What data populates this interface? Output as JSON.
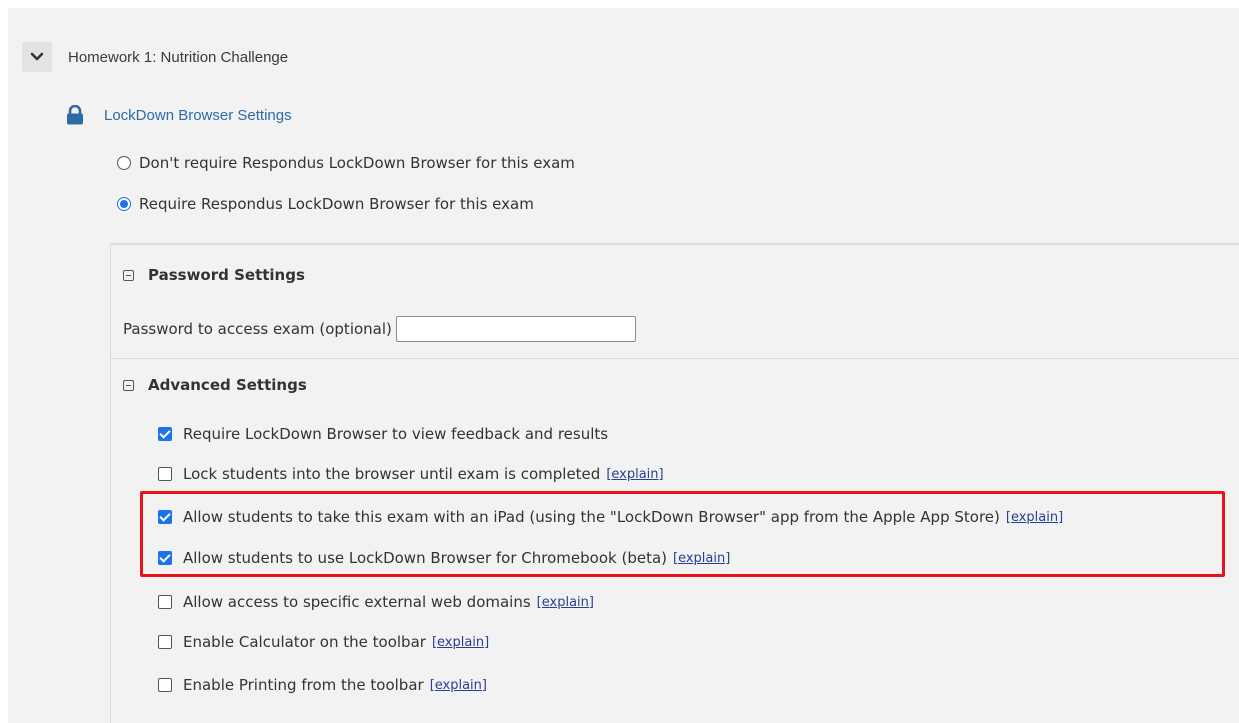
{
  "exam": {
    "title": "Homework 1: Nutrition Challenge"
  },
  "lockdown": {
    "link_label": "LockDown Browser Settings",
    "radio_options": [
      {
        "label": "Don't require Respondus LockDown Browser for this exam",
        "selected": false
      },
      {
        "label": "Require Respondus LockDown Browser for this exam",
        "selected": true
      }
    ]
  },
  "password_settings": {
    "heading": "Password Settings",
    "field_label": "Password to access exam (optional)",
    "field_value": ""
  },
  "advanced_settings": {
    "heading": "Advanced Settings",
    "explain_label": "[explain]",
    "options": [
      {
        "label": "Require LockDown Browser to view feedback and results",
        "checked": true,
        "has_explain": false
      },
      {
        "label": "Lock students into the browser until exam is completed",
        "checked": false,
        "has_explain": true
      },
      {
        "label": "Allow students to take this exam with an iPad (using the \"LockDown Browser\" app from the Apple App Store)",
        "checked": true,
        "has_explain": true
      },
      {
        "label": "Allow students to use LockDown Browser for Chromebook (beta)",
        "checked": true,
        "has_explain": true
      },
      {
        "label": "Allow access to specific external web domains",
        "checked": false,
        "has_explain": true
      },
      {
        "label": "Enable Calculator on the toolbar",
        "checked": false,
        "has_explain": true
      },
      {
        "label": "Enable Printing from the toolbar",
        "checked": false,
        "has_explain": true
      }
    ]
  },
  "colors": {
    "accent": "#1a73e8",
    "link": "#2e6aa6",
    "highlight": "#e3141c",
    "panel_bg": "#f2f2f2"
  },
  "icons": {
    "expand": "chevron-down-icon",
    "lock": "lock-icon",
    "collapse": "minus-square-icon"
  }
}
